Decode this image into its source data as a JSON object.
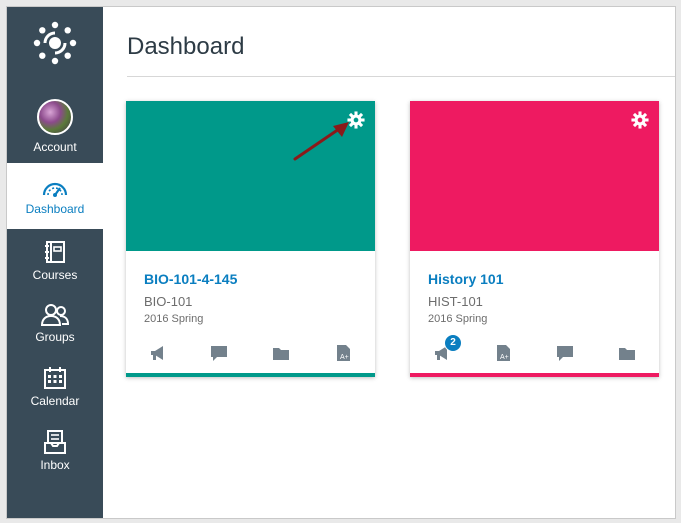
{
  "sidebar": {
    "bg": "#394b58",
    "items": [
      {
        "label": "Account",
        "icon": "avatar"
      },
      {
        "label": "Dashboard",
        "icon": "dashboard-icon",
        "active": true
      },
      {
        "label": "Courses",
        "icon": "courses-icon"
      },
      {
        "label": "Groups",
        "icon": "groups-icon"
      },
      {
        "label": "Calendar",
        "icon": "calendar-icon"
      },
      {
        "label": "Inbox",
        "icon": "inbox-icon"
      }
    ]
  },
  "page": {
    "title": "Dashboard"
  },
  "cards": [
    {
      "title": "BIO-101-4-145",
      "code": "BIO-101",
      "term": "2016 Spring",
      "color": "#00998a",
      "title_color": "#0a7ec0",
      "actions": [
        "announcements-icon",
        "discussions-icon",
        "files-icon",
        "grades-icon"
      ]
    },
    {
      "title": "History 101",
      "code": "HIST-101",
      "term": "2016 Spring",
      "color": "#ee1a61",
      "title_color": "#0a7ec0",
      "actions": [
        "announcements-icon",
        "grades-icon",
        "discussions-icon",
        "files-icon"
      ],
      "announcement_badge": "2"
    }
  ],
  "colors": {
    "accent": "#0a7ec0",
    "arrow": "#8b1a1a"
  }
}
